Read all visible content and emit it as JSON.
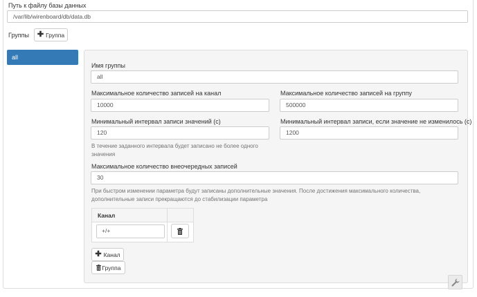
{
  "db_path": {
    "label": "Путь к файлу базы данных",
    "value": "/var/lib/wirenboard/db/data.db"
  },
  "groups": {
    "label": "Группы",
    "add_button": "Группа",
    "nav_items": [
      "all"
    ]
  },
  "group_form": {
    "name_label": "Имя группы",
    "name_value": "all",
    "max_records_channel_label": "Максимальное количество записей на канал",
    "max_records_channel_value": "10000",
    "max_records_group_label": "Максимальное количество записей на группу",
    "max_records_group_value": "500000",
    "min_interval_label": "Минимальный интервал записи значений (с)",
    "min_interval_value": "120",
    "min_interval_help": [
      "В течение заданного интервала будет записано не более одного",
      "значения"
    ],
    "min_interval_unchanged_label": "Минимальный интервал записи, если значение не изменилось (с)",
    "min_interval_unchanged_value": "1200",
    "max_extra_label": "Максимальное количество внеочередных записей",
    "max_extra_value": "30",
    "max_extra_help": [
      "При быстром изменении параметра будут записаны дополнительные значения. После достижения максимального количества,",
      "дополнительные записи прекращаются до стабилизации параметра"
    ],
    "channel_table": {
      "header": "Канал",
      "rows": [
        "+/+"
      ]
    },
    "add_channel_button": "Канал",
    "delete_group_button": "Группа"
  },
  "colors": {
    "nav_active": "#337ab7",
    "panel_bg": "#f5f5f5",
    "border": "#dddddd"
  },
  "icons": {
    "add": "plus-icon",
    "delete": "trash-icon",
    "settings": "wrench-icon"
  }
}
